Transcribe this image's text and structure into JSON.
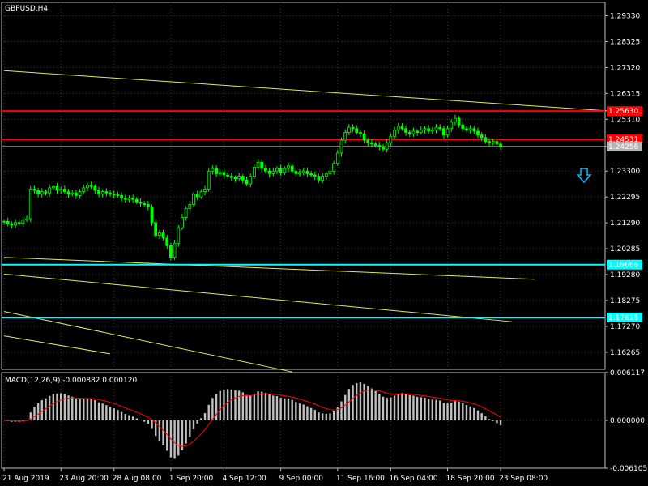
{
  "window": {
    "symbol_label": "GBPUSD,H4"
  },
  "colors": {
    "background": "#000000",
    "grid": "#3a3a3a",
    "frame": "#c0c0c0",
    "candle": "#00ff00",
    "trendline": "#e6e65c",
    "resistance": "#ff0000",
    "support": "#00ffff",
    "bid": "#b4b4b4",
    "macd_hist": "#c0c0c0",
    "macd_signal": "#ff0000",
    "arrow": "#00bfff"
  },
  "chart_data": {
    "type": "candlestick",
    "y_ticks": [
      "1.29330",
      "1.28325",
      "1.27320",
      "1.26315",
      "1.25310",
      "1.24256",
      "1.23300",
      "1.22295",
      "1.21290",
      "1.20285",
      "1.19280",
      "1.18275",
      "1.17270",
      "1.16265"
    ],
    "ylim": [
      1.156,
      1.2985
    ],
    "x_ticks": [
      "21 Aug 2019",
      "23 Aug 20:00",
      "28 Aug 08:00",
      "1 Sep 20:00",
      "4 Sep 12:00",
      "9 Sep 00:00",
      "11 Sep 16:00",
      "16 Sep 04:00",
      "18 Sep 20:00",
      "23 Sep 08:00"
    ],
    "closes": [
      1.2135,
      1.2125,
      1.212,
      1.213,
      1.2128,
      1.214,
      1.2145,
      1.226,
      1.2255,
      1.224,
      1.225,
      1.2245,
      1.2265,
      1.227,
      1.2255,
      1.226,
      1.225,
      1.224,
      1.2245,
      1.2235,
      1.225,
      1.2265,
      1.2275,
      1.227,
      1.2255,
      1.224,
      1.225,
      1.2245,
      1.224,
      1.2238,
      1.2235,
      1.2225,
      1.222,
      1.2225,
      1.222,
      1.221,
      1.2205,
      1.22,
      1.219,
      1.213,
      1.208,
      1.209,
      1.207,
      1.204,
      1.1995,
      1.205,
      1.211,
      1.215,
      1.2185,
      1.22,
      1.224,
      1.223,
      1.225,
      1.226,
      1.233,
      1.234,
      1.232,
      1.2325,
      1.2315,
      1.231,
      1.2305,
      1.23,
      1.231,
      1.2295,
      1.228,
      1.231,
      1.2345,
      1.2365,
      1.234,
      1.233,
      1.232,
      1.233,
      1.234,
      1.2325,
      1.234,
      1.235,
      1.233,
      1.232,
      1.2325,
      1.233,
      1.232,
      1.2315,
      1.231,
      1.2295,
      1.231,
      1.232,
      1.233,
      1.236,
      1.24,
      1.245,
      1.248,
      1.25,
      1.2495,
      1.248,
      1.2475,
      1.245,
      1.244,
      1.2435,
      1.243,
      1.2425,
      1.2415,
      1.244,
      1.2465,
      1.249,
      1.2505,
      1.2495,
      1.248,
      1.2475,
      1.2485,
      1.248,
      1.249,
      1.2495,
      1.2485,
      1.249,
      1.25,
      1.2495,
      1.247,
      1.2495,
      1.252,
      1.2535,
      1.251,
      1.2495,
      1.249,
      1.2495,
      1.2485,
      1.247,
      1.246,
      1.2445,
      1.244,
      1.2445,
      1.2435,
      1.2425
    ],
    "horizontal_levels": [
      {
        "value": 1.2563,
        "label": "1.25630",
        "kind": "resistance"
      },
      {
        "value": 1.24531,
        "label": "1.24531",
        "kind": "resistance"
      },
      {
        "value": 1.24256,
        "label": "1.24256",
        "kind": "bid"
      },
      {
        "value": 1.19666,
        "label": "1.19666",
        "kind": "support"
      },
      {
        "value": 1.17615,
        "label": "1.17615",
        "kind": "support"
      }
    ],
    "trendlines": [
      {
        "from": [
          0,
          1.272
        ],
        "to": [
          168,
          1.2555
        ]
      },
      {
        "from": [
          0,
          1.1995
        ],
        "to": [
          140,
          1.191
        ]
      },
      {
        "from": [
          0,
          1.193
        ],
        "to": [
          134,
          1.1745
        ]
      },
      {
        "from": [
          0,
          1.1785
        ],
        "to": [
          76,
          1.155
        ]
      },
      {
        "from": [
          0,
          1.169
        ],
        "to": [
          28,
          1.162
        ]
      }
    ],
    "signal_arrow": {
      "direction": "down",
      "bar": 153,
      "value": 1.2315
    },
    "macd": {
      "label": "MACD(12,26,9) -0.000882 0.000120",
      "y_ticks": [
        "0.006117",
        "0.000000",
        "-0.006105"
      ],
      "ylim": [
        -0.0061,
        0.0061
      ]
    }
  }
}
